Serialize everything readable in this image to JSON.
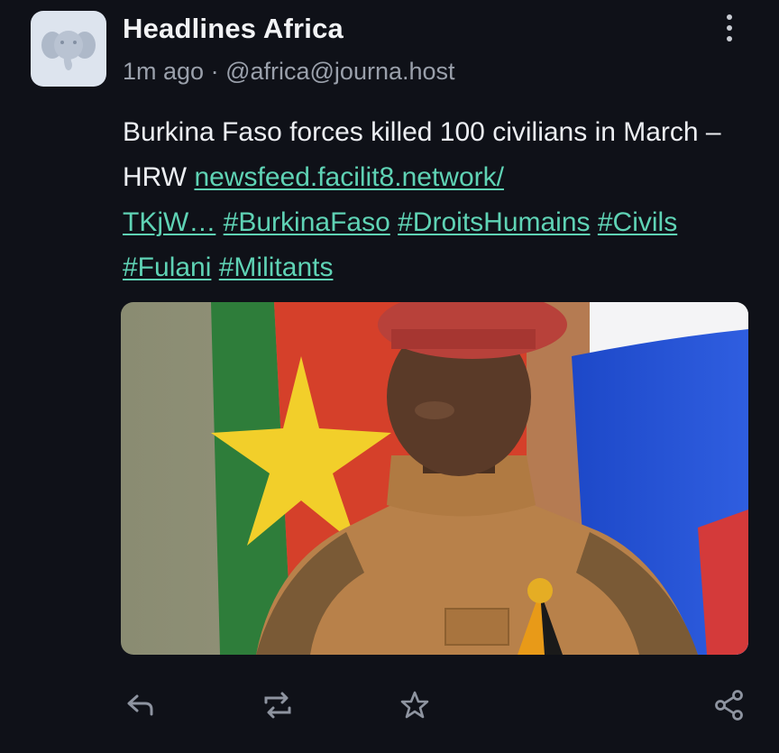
{
  "post": {
    "author": {
      "display_name": "Headlines Africa",
      "avatar_icon": "elephant-icon"
    },
    "time": "1m ago",
    "separator": "·",
    "handle": "@africa@journa.host",
    "content": {
      "text": "Burkina Faso forces killed 100 civilians in March – HRW",
      "link": "newsfeed.facilit8.network/TKjW…",
      "link_line1": "newsfeed.facilit8.network/",
      "link_line2": "TKjW…",
      "hashtags": [
        "#BurkinaFaso",
        "#DroitsHumains",
        "#Civils",
        "#Fulani",
        "#Militants"
      ]
    },
    "media": {
      "type": "photo"
    },
    "actions": [
      {
        "name": "reply",
        "icon": "reply-icon"
      },
      {
        "name": "boost",
        "icon": "boost-icon"
      },
      {
        "name": "favourite",
        "icon": "star-icon"
      },
      {
        "name": "share",
        "icon": "share-icon"
      }
    ]
  },
  "colors": {
    "background": "#0f1118",
    "text": "#eceef2",
    "secondary": "#9aa0ab",
    "link": "#5fd3b5",
    "avatar_bg": "#dde4ee"
  }
}
